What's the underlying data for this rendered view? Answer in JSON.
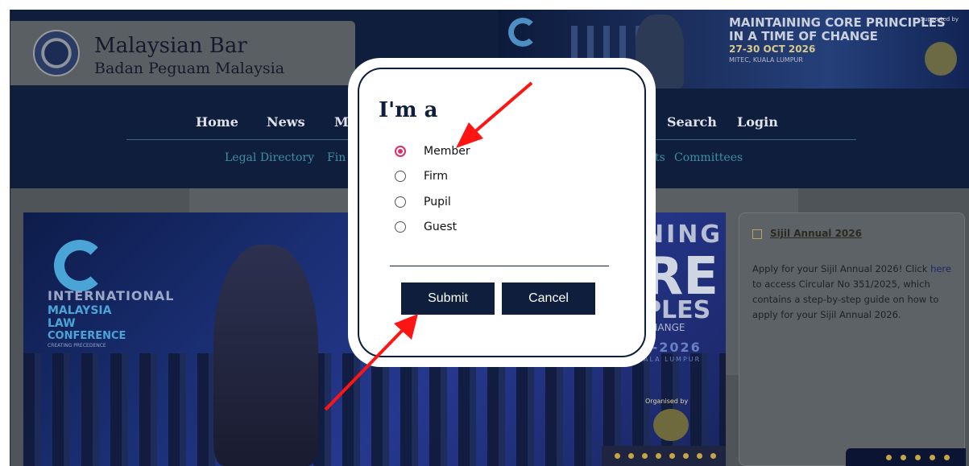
{
  "header": {
    "logo_title": "Malaysian Bar",
    "logo_subtitle": "Badan Peguam Malaysia",
    "banner": {
      "line1": "MAINTAINING CORE PRINCIPLES",
      "line2": "IN A TIME OF CHANGE",
      "line3": "27-30 OCT 2026",
      "line4": "MITEC, KUALA LUMPUR",
      "supported": "Supported by"
    }
  },
  "nav": {
    "items": [
      "Home",
      "News",
      "M",
      "Search",
      "Login"
    ]
  },
  "subnav": {
    "items": [
      "Legal Directory",
      "Fin",
      "ts",
      "Committees"
    ]
  },
  "slider": {
    "left_line1": "INTERNATIONAL",
    "left_line2": "MALAYSIA",
    "left_line3": "LAW",
    "left_line4": "CONFERENCE",
    "left_line5": "CREATING PRECEDENCE",
    "right_line1": "NING",
    "right_line2": "RE",
    "right_line3": "PLES",
    "right_line4": "CHANGE",
    "right_line5": "T-2026",
    "right_line6": "ALA LUMPUR",
    "organised": "Organised by",
    "dot_count": 8
  },
  "sidebar": {
    "link": "Sijil Annual 2026",
    "text_before": "Apply for your Sijil Annual 2026! Click ",
    "text_link": "here",
    "text_after": " to access Circular No 351/2025, which contains a step-by-step guide on how to apply for your Sijil Annual 2026.",
    "dot_count": 5
  },
  "modal": {
    "title": "I'm a",
    "options": [
      {
        "label": "Member",
        "checked": true
      },
      {
        "label": "Firm",
        "checked": false
      },
      {
        "label": "Pupil",
        "checked": false
      },
      {
        "label": "Guest",
        "checked": false
      }
    ],
    "submit": "Submit",
    "cancel": "Cancel"
  },
  "colors": {
    "navy": "#0f1e3c",
    "radio_accent": "#d6336c",
    "annotation_arrow": "#ff1414",
    "gold": "#c5a544"
  }
}
